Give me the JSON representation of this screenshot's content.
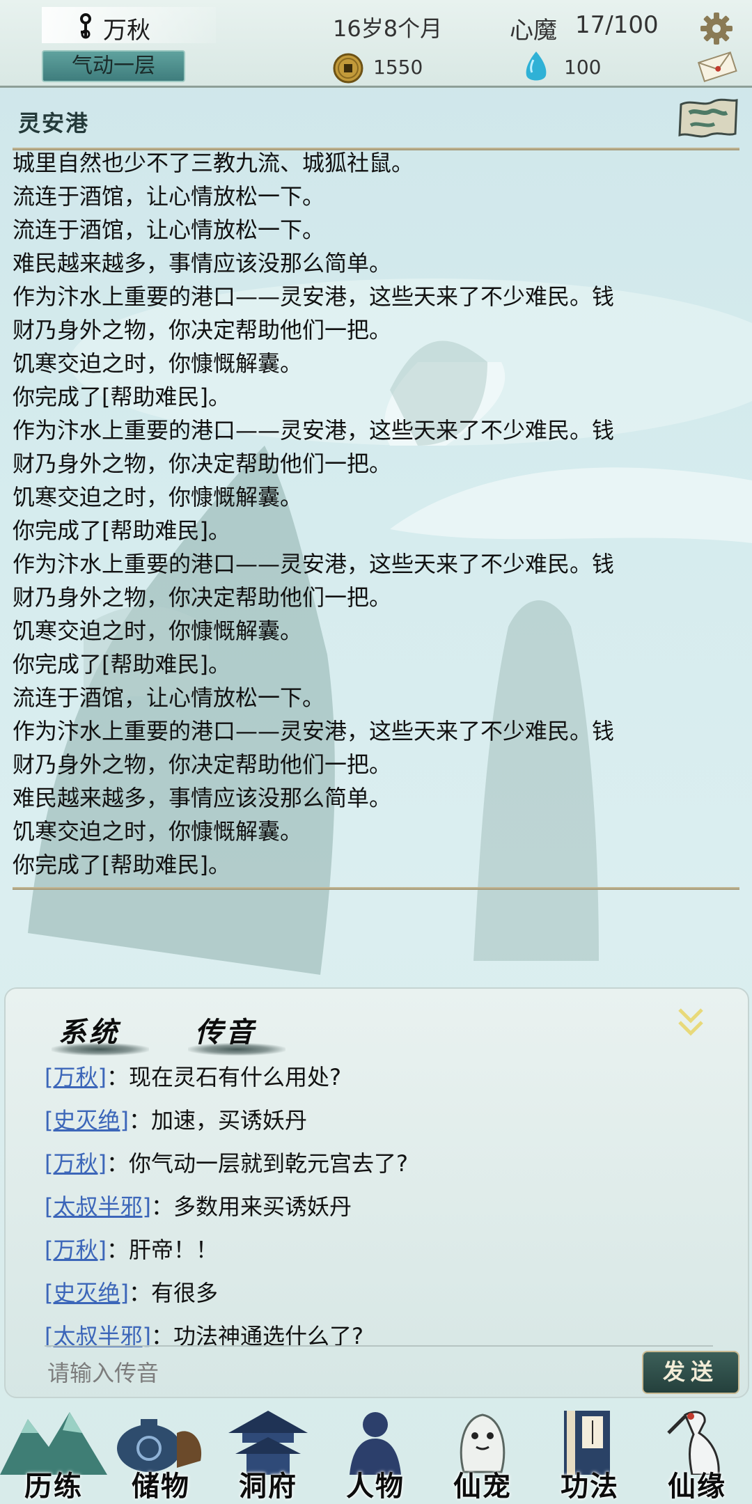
{
  "header": {
    "player_name": "万秋",
    "realm": "气动一层",
    "age": "16岁8个月",
    "mind_demon_label": "心魔",
    "mind_demon_value": "17/100",
    "coins": "1550",
    "spirit_stones": "100"
  },
  "location": {
    "name": "灵安港"
  },
  "log": {
    "lines": [
      "城里自然也少不了三教九流、城狐社鼠。",
      "流连于酒馆，让心情放松一下。",
      "流连于酒馆，让心情放松一下。",
      "难民越来越多，事情应该没那么简单。",
      "作为汴水上重要的港口——灵安港，这些天来了不少难民。钱",
      "财乃身外之物，你决定帮助他们一把。",
      "饥寒交迫之时，你慷慨解囊。",
      "你完成了[帮助难民]。",
      "作为汴水上重要的港口——灵安港，这些天来了不少难民。钱",
      "财乃身外之物，你决定帮助他们一把。",
      "饥寒交迫之时，你慷慨解囊。",
      "你完成了[帮助难民]。",
      "作为汴水上重要的港口——灵安港，这些天来了不少难民。钱",
      "财乃身外之物，你决定帮助他们一把。",
      "饥寒交迫之时，你慷慨解囊。",
      "你完成了[帮助难民]。",
      "流连于酒馆，让心情放松一下。",
      "作为汴水上重要的港口——灵安港，这些天来了不少难民。钱",
      "财乃身外之物，你决定帮助他们一把。",
      "难民越来越多，事情应该没那么简单。",
      "饥寒交迫之时，你慷慨解囊。",
      "你完成了[帮助难民]。"
    ]
  },
  "chat": {
    "tabs": [
      "系统",
      "传音"
    ],
    "messages": [
      {
        "name": "[万秋]",
        "sep": "：",
        "text": "现在灵石有什么用处?"
      },
      {
        "name": "[史灭绝]",
        "sep": "：",
        "text": "加速，买诱妖丹"
      },
      {
        "name": "[万秋]",
        "sep": "：",
        "text": "你气动一层就到乾元宫去了?"
      },
      {
        "name": "[太叔半邪]",
        "sep": "：",
        "text": "多数用来买诱妖丹"
      },
      {
        "name": "[万秋]",
        "sep": "：",
        "text": "肝帝！！"
      },
      {
        "name": "[史灭绝]",
        "sep": "：",
        "text": "有很多"
      },
      {
        "name": "[太叔半邪]",
        "sep": "：",
        "text": "功法神通选什么了?"
      }
    ],
    "input_placeholder": "请输入传音",
    "send_label": "发送"
  },
  "nav": {
    "items": [
      {
        "label": "历练",
        "icon": "mountain-icon"
      },
      {
        "label": "储物",
        "icon": "storage-bag-icon"
      },
      {
        "label": "洞府",
        "icon": "pavilion-icon"
      },
      {
        "label": "人物",
        "icon": "character-icon"
      },
      {
        "label": "仙宠",
        "icon": "spirit-pet-icon"
      },
      {
        "label": "功法",
        "icon": "scripture-book-icon"
      },
      {
        "label": "仙缘",
        "icon": "crane-icon"
      }
    ]
  },
  "colors": {
    "chat_name": "#3c66b9",
    "realm_badge": "#4f908e",
    "send_button": "#2e4d48"
  }
}
